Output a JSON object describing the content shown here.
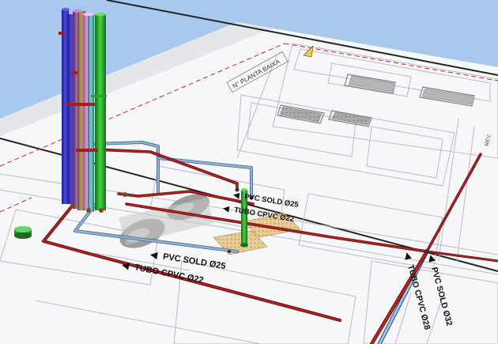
{
  "viewport": {
    "background_color": "#a9c8ee",
    "plane_color": "#f7f8fa"
  },
  "drawing": {
    "stamp_text": "N° PLANTA BAIXA",
    "side_mark_text": "REV."
  },
  "pipe_labels": [
    {
      "id": "pvc-sold-25-top",
      "text": "PVC SOLD Ø25"
    },
    {
      "id": "tubo-cpvc-22-top",
      "text": "TUBO CPVC Ø22"
    },
    {
      "id": "pvc-sold-25-bottom",
      "text": "PVC SOLD Ø25"
    },
    {
      "id": "tubo-cpvc-22-bottom",
      "text": "TUBO CPVC Ø22"
    },
    {
      "id": "tubo-cpvc-28-diag",
      "text": "TUBO CPVC Ø28"
    },
    {
      "id": "pvc-sold-32-diag",
      "text": "PVC SOLD Ø32"
    }
  ],
  "pipe_colors": {
    "hot_water": "#a01818",
    "cold_water": "#6f95bd",
    "riser_blue": "#2a2ab8",
    "riser_purple": "#8a4a9e",
    "riser_brown": "#9a6a4a",
    "riser_pink": "#d68ad0",
    "riser_green": "#22a022",
    "riser_teal": "#4aa6a6"
  }
}
